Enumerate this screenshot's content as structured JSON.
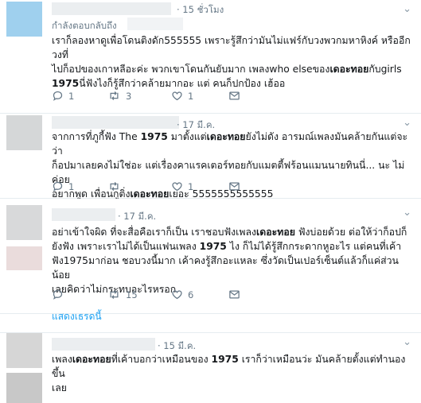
{
  "tweets": [
    {
      "date": "· 15 ชั่วโมง",
      "replying_to": "กำลังตอบกลับถึง",
      "body": [
        [
          {
            "t": "เราก็ลองหาดูเพื่อโดนติงดัก555555 เพราะรู้สึกว่ามันไม่แฟร์กับวงพวกมหาหิงค์ หรืออีกวงที่"
          }
        ],
        [
          {
            "t": "ไปก็อปของเกาหลีอะค่ะ พวกเขาโดนกันยับมาก เพลงwho elseของ"
          },
          {
            "t": "เดอะทอย",
            "b": true
          },
          {
            "t": "กับgirls"
          }
        ],
        [
          {
            "t": "1975",
            "b": true
          },
          {
            "t": "นี่ฟังไงก็รู้สึกว่าคล้ายมากอะ แต่ คนก็ปกป้อง เฮ้ออ"
          }
        ]
      ],
      "actions": {
        "replies": "1",
        "retweets": "3",
        "likes": "1"
      }
    },
    {
      "date": "· 17 มี.ค.",
      "body": [
        [
          {
            "t": "จากการที่ภูกี้ฟัง The "
          },
          {
            "t": "1975",
            "b": true
          },
          {
            "t": " มาตั้งแต่"
          },
          {
            "t": "เดอะทอย",
            "b": true
          },
          {
            "t": "ยังไม่ดัง อารมณ์เพลงมันคล้ายกันแต่จะว่า"
          }
        ],
        [
          {
            "t": "ก็อปมาเลยคงไม่ใช่อะ แต่เรื่องคาแรคเตอร์ทอยกับแมตตี้ฟร้อนแมนนายทินนี่... นะ ไม่ค่อย"
          }
        ],
        [
          {
            "t": "อยากพูด เพื่อนกูติ่ง"
          },
          {
            "t": "เดอะทอย",
            "b": true
          },
          {
            "t": "เยอะ 5555555555555"
          }
        ]
      ],
      "actions": {
        "replies": "1",
        "retweets": "",
        "likes": "1"
      }
    },
    {
      "date": "· 17 มี.ค.",
      "body": [
        [
          {
            "t": "อย่าเข้าใจผิด ที่จะสื่อคือเราก็เป็น เราชอบฟังเพลง"
          },
          {
            "t": "เดอะทอย",
            "b": true
          },
          {
            "t": " ฟังบ่อยด้วย ต่อให้ว่าก็อปก็"
          }
        ],
        [
          {
            "t": "ยังฟัง เพราะเราไม่ได้เป็นแฟนเพลง "
          },
          {
            "t": "1975",
            "b": true
          },
          {
            "t": " ไง ก็ไม่ได้รู้สึกกระดากหูอะไร แต่คนที่เค้า"
          }
        ],
        [
          {
            "t": "ฟัง1975มาก่อน ชอบวงนี้มาก เค้าคงรู้สึกอะแหละ ซึ่งวัดเป็นเปอร์เซ็นต์แล้วก็แค่ส่วนน้อย"
          }
        ],
        [
          {
            "t": "เลยคิดว่าไม่กระทบอะไรหรอก"
          }
        ]
      ],
      "actions": {
        "replies": "",
        "retweets": "15",
        "likes": "6"
      },
      "show_thread": "แสดงเธรดนี้"
    },
    {
      "date": "· 15 มี.ค.",
      "body": [
        [
          {
            "t": "เพลง"
          },
          {
            "t": "เดอะทอย",
            "b": true
          },
          {
            "t": "ที่เค้าบอกว่าเหมือนของ "
          },
          {
            "t": "1975",
            "b": true
          },
          {
            "t": " เราก็ว่าเหมือนว่ะ มันคล้ายตั้งแต่ทำนองขึ้น"
          }
        ],
        [
          {
            "t": "เลย"
          }
        ]
      ]
    }
  ],
  "colors": {
    "accent": "#1da1f2",
    "muted": "#657786",
    "border": "#e6ecf0"
  }
}
